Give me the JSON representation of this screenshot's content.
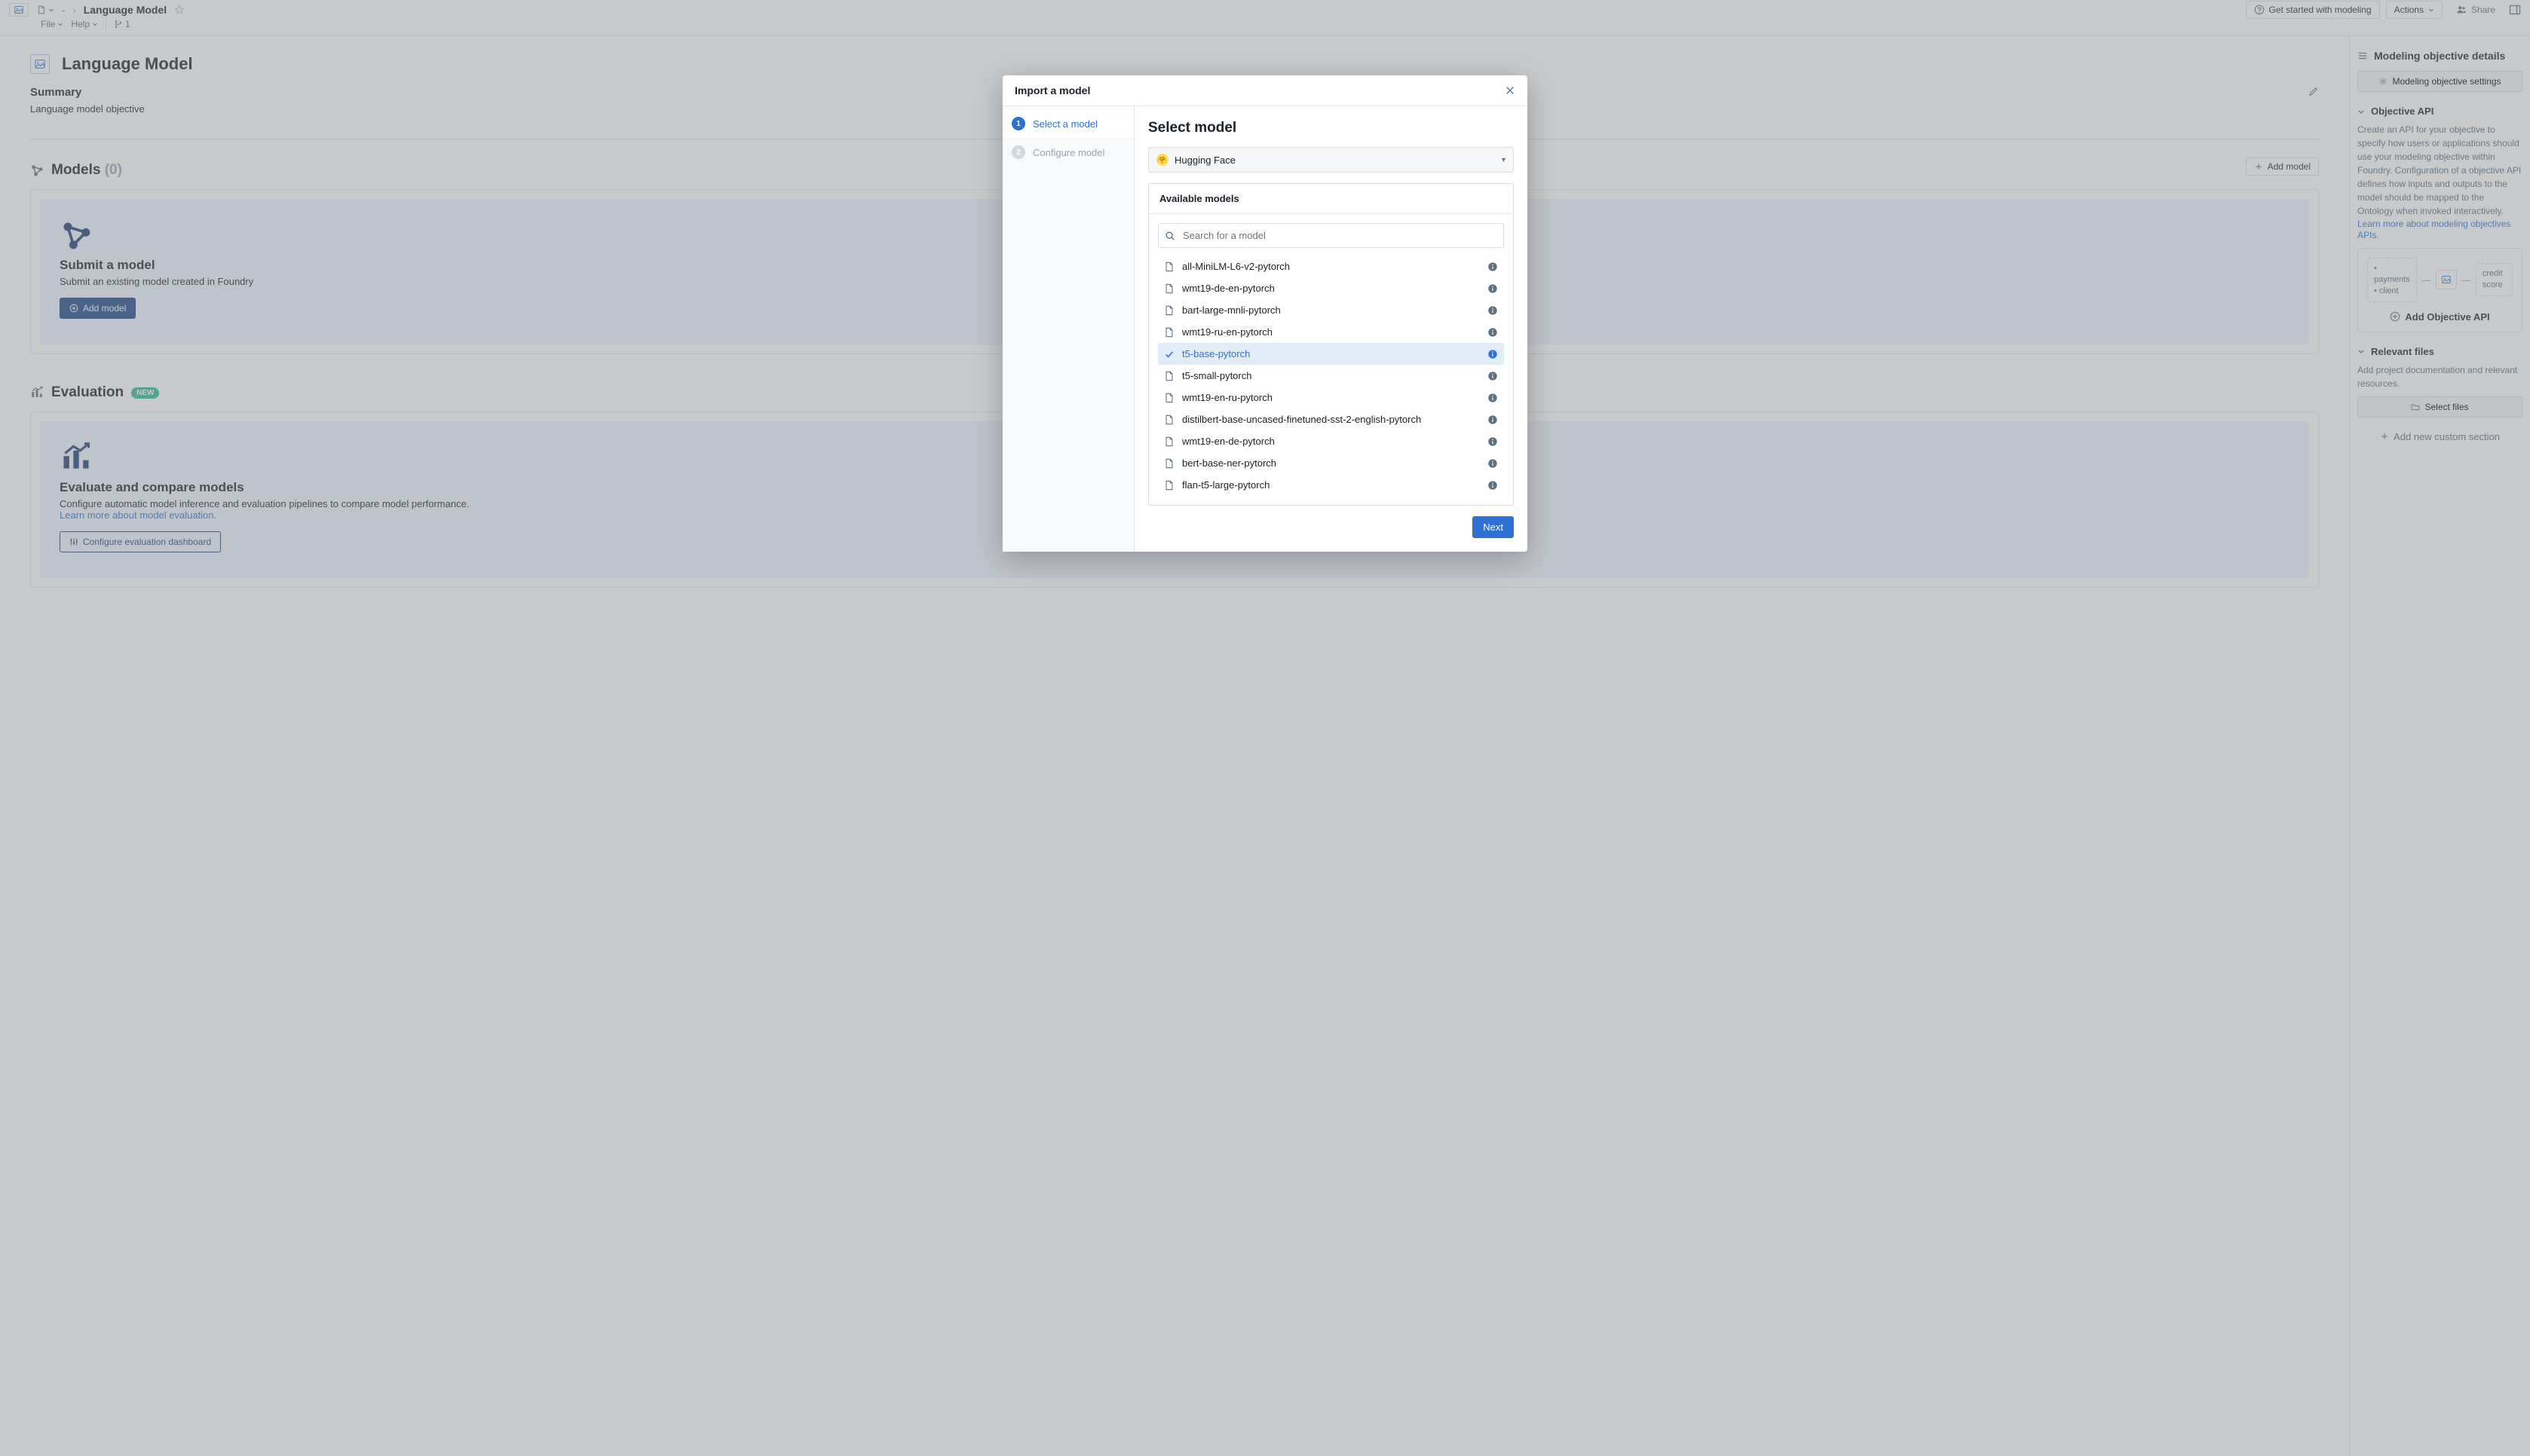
{
  "topbar": {
    "folder_label": "-",
    "page_title": "Language Model",
    "get_started": "Get started with modeling",
    "actions": "Actions",
    "share": "Share"
  },
  "menubar": {
    "file": "File",
    "help": "Help",
    "branch_count": "1"
  },
  "page": {
    "heading": "Language Model",
    "summary_title": "Summary",
    "summary_text": "Language model objective"
  },
  "models": {
    "title": "Models",
    "count": "(0)",
    "add_model": "Add model",
    "card_title": "Submit a model",
    "card_desc": "Submit an existing model created in Foundry",
    "card_btn": "Add model"
  },
  "evaluation": {
    "title": "Evaluation",
    "badge": "NEW",
    "card_title": "Evaluate and compare models",
    "card_desc": "Configure automatic model inference and evaluation pipelines to compare model performance.",
    "card_link": "Learn more about model evaluation.",
    "card_btn": "Configure evaluation dashboard"
  },
  "right": {
    "details_title": "Modeling objective details",
    "settings_btn": "Modeling objective settings",
    "api_title": "Objective API",
    "api_text": "Create an API for your objective to specify how users or applications should use your modeling objective within Foundry. Configuration of a objective API defines how inputs and outputs to the model should be mapped to the Ontology when invoked interactively.",
    "api_link": "Learn more about modeling objectives APIs.",
    "api_box1_line1": "• payments",
    "api_box1_line2": "• client",
    "api_box2": "credit score",
    "api_add": "Add Objective API",
    "files_title": "Relevant files",
    "files_text": "Add project documentation and relevant resources.",
    "files_btn": "Select files",
    "add_section": "Add new custom section"
  },
  "modal": {
    "title": "Import a model",
    "step1": "Select a model",
    "step2": "Configure model",
    "heading": "Select model",
    "provider": "Hugging Face",
    "available": "Available models",
    "search_placeholder": "Search for a model",
    "next": "Next",
    "models": [
      {
        "name": "all-MiniLM-L6-v2-pytorch",
        "selected": false
      },
      {
        "name": "wmt19-de-en-pytorch",
        "selected": false
      },
      {
        "name": "bart-large-mnli-pytorch",
        "selected": false
      },
      {
        "name": "wmt19-ru-en-pytorch",
        "selected": false
      },
      {
        "name": "t5-base-pytorch",
        "selected": true
      },
      {
        "name": "t5-small-pytorch",
        "selected": false
      },
      {
        "name": "wmt19-en-ru-pytorch",
        "selected": false
      },
      {
        "name": "distilbert-base-uncased-finetuned-sst-2-english-pytorch",
        "selected": false
      },
      {
        "name": "wmt19-en-de-pytorch",
        "selected": false
      },
      {
        "name": "bert-base-ner-pytorch",
        "selected": false
      },
      {
        "name": "flan-t5-large-pytorch",
        "selected": false
      }
    ]
  }
}
